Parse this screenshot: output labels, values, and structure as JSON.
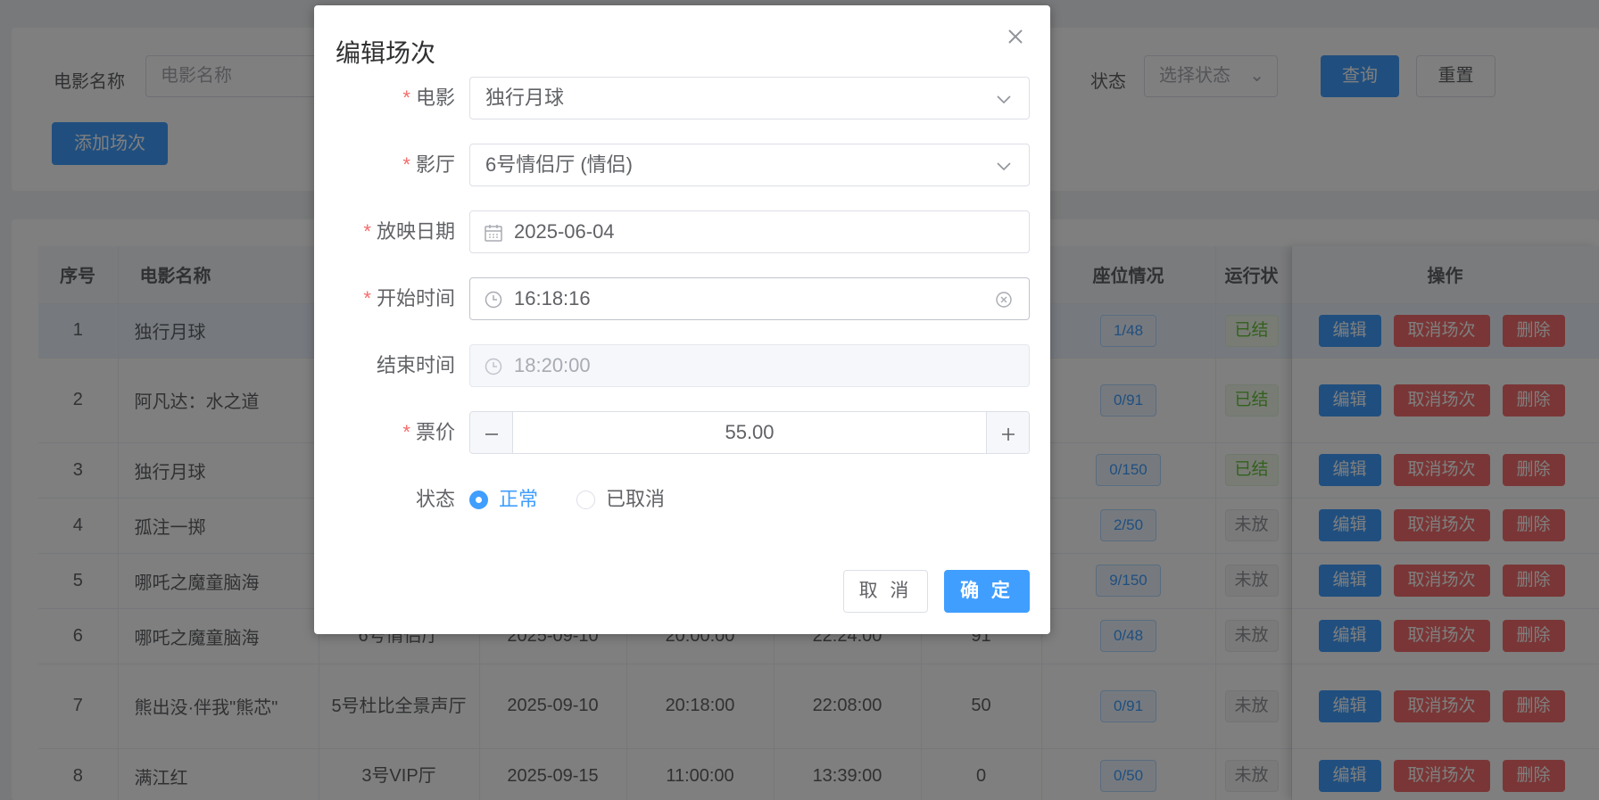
{
  "search": {
    "movie_label": "电影名称",
    "movie_placeholder": "电影名称",
    "status_label": "状态",
    "status_placeholder": "选择状态",
    "query_button": "查询",
    "reset_button": "重置",
    "add_button": "添加场次"
  },
  "table": {
    "headers": [
      "序号",
      "电影名称",
      "",
      "",
      "",
      "",
      "",
      "座位情况",
      "运行状",
      "操作"
    ],
    "rows": [
      {
        "index": "1",
        "movie": "独行月球",
        "hall": "",
        "date": "",
        "start": "",
        "end": "",
        "price": "",
        "seats": "1/48",
        "status": "已结",
        "status_type": "done"
      },
      {
        "index": "2",
        "movie": "阿凡达：水之道",
        "hall": "",
        "date": "",
        "start": "",
        "end": "",
        "price": "",
        "seats": "0/91",
        "status": "已结",
        "status_type": "done"
      },
      {
        "index": "3",
        "movie": "独行月球",
        "hall": "",
        "date": "",
        "start": "",
        "end": "",
        "price": "",
        "seats": "0/150",
        "status": "已结",
        "status_type": "done"
      },
      {
        "index": "4",
        "movie": "孤注一掷",
        "hall": "",
        "date": "",
        "start": "",
        "end": "",
        "price": "",
        "seats": "2/50",
        "status": "未放",
        "status_type": "wait"
      },
      {
        "index": "5",
        "movie": "哪吒之魔童脑海",
        "hall": "",
        "date": "",
        "start": "",
        "end": "",
        "price": "",
        "seats": "9/150",
        "status": "未放",
        "status_type": "wait"
      },
      {
        "index": "6",
        "movie": "哪吒之魔童脑海",
        "hall": "6号情侣厅",
        "date": "2025-09-10",
        "start": "20:00:00",
        "end": "22:24:00",
        "price": "91",
        "seats": "0/48",
        "status": "未放",
        "status_type": "wait"
      },
      {
        "index": "7",
        "movie": "熊出没·伴我\"熊芯\"",
        "hall": "5号杜比全景声厅",
        "date": "2025-09-10",
        "start": "20:18:00",
        "end": "22:08:00",
        "price": "50",
        "seats": "0/91",
        "status": "未放",
        "status_type": "wait"
      },
      {
        "index": "8",
        "movie": "满江红",
        "hall": "3号VIP厅",
        "date": "2025-09-15",
        "start": "11:00:00",
        "end": "13:39:00",
        "price": "0",
        "seats": "0/50",
        "status": "未放",
        "status_type": "wait"
      }
    ],
    "actions": {
      "edit": "编辑",
      "cancel": "取消场次",
      "delete": "删除"
    }
  },
  "dialog": {
    "title": "编辑场次",
    "fields": {
      "movie": {
        "label": "电影",
        "value": "独行月球",
        "required": true
      },
      "hall": {
        "label": "影厅",
        "value": "6号情侣厅 (情侣)",
        "required": true
      },
      "date": {
        "label": "放映日期",
        "value": "2025-06-04",
        "required": true
      },
      "start": {
        "label": "开始时间",
        "value": "16:18:16",
        "required": true
      },
      "end": {
        "label": "结束时间",
        "value": "18:20:00",
        "required": false
      },
      "price": {
        "label": "票价",
        "value": "55.00",
        "required": true
      },
      "status": {
        "label": "状态",
        "options": [
          "正常",
          "已取消"
        ],
        "selected": "正常"
      }
    },
    "required_mark": "*",
    "cancel_button": "取 消",
    "confirm_button": "确 定"
  },
  "colors": {
    "primary": "#409eff",
    "danger": "#f56c6c",
    "success": "#67c23a",
    "mask": "rgba(0,0,0,0.5)"
  }
}
